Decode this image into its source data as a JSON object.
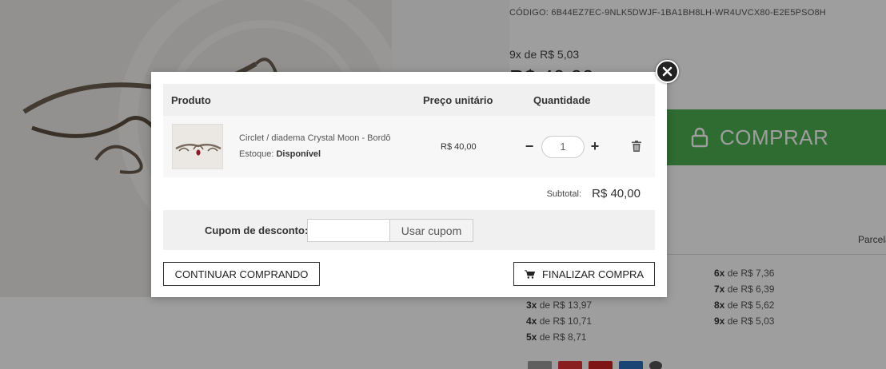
{
  "background": {
    "product_code_label": "CÓDIGO:",
    "product_code": "6B44EZ7EC-9NLK5DWJF-1BA1BH8LH-WR4UVCX80-E2E5PSO8H",
    "installment_top": "9x de R$ 5,03",
    "price_big": "R$ 40,00",
    "buy_button_label": "COMPRAR",
    "tab_label": "Parcela",
    "installments_left": [
      {
        "n": "3x",
        "text": "de R$ 13,97"
      },
      {
        "n": "4x",
        "text": "de R$ 10,71"
      },
      {
        "n": "5x",
        "text": "de R$ 8,71"
      }
    ],
    "installments_right": [
      {
        "n": "6x",
        "text": "de R$ 7,36"
      },
      {
        "n": "7x",
        "text": "de R$ 6,39"
      },
      {
        "n": "8x",
        "text": "de R$ 5,62"
      },
      {
        "n": "9x",
        "text": "de R$ 5,03"
      }
    ]
  },
  "cart": {
    "headers": {
      "product": "Produto",
      "unit_price": "Preço unitário",
      "quantity": "Quantidade"
    },
    "items": [
      {
        "name": "Circlet / diadema Crystal Moon - Bordô",
        "stock_label": "Estoque:",
        "stock_value": "Disponível",
        "unit_price": "R$ 40,00",
        "quantity": "1",
        "thumb_icon": "product-thumbnail"
      }
    ],
    "subtotal_label": "Subtotal:",
    "subtotal_value": "R$ 40,00",
    "coupon_label": "Cupom de desconto:",
    "coupon_value": "",
    "coupon_button": "Usar cupom",
    "continue_button": "CONTINUAR COMPRANDO",
    "checkout_button": "FINALIZAR COMPRA",
    "checkout_icon": "cart-icon"
  },
  "colors": {
    "buy_button": "#4caf50",
    "overlay": "rgba(0,0,0,0.38)"
  }
}
